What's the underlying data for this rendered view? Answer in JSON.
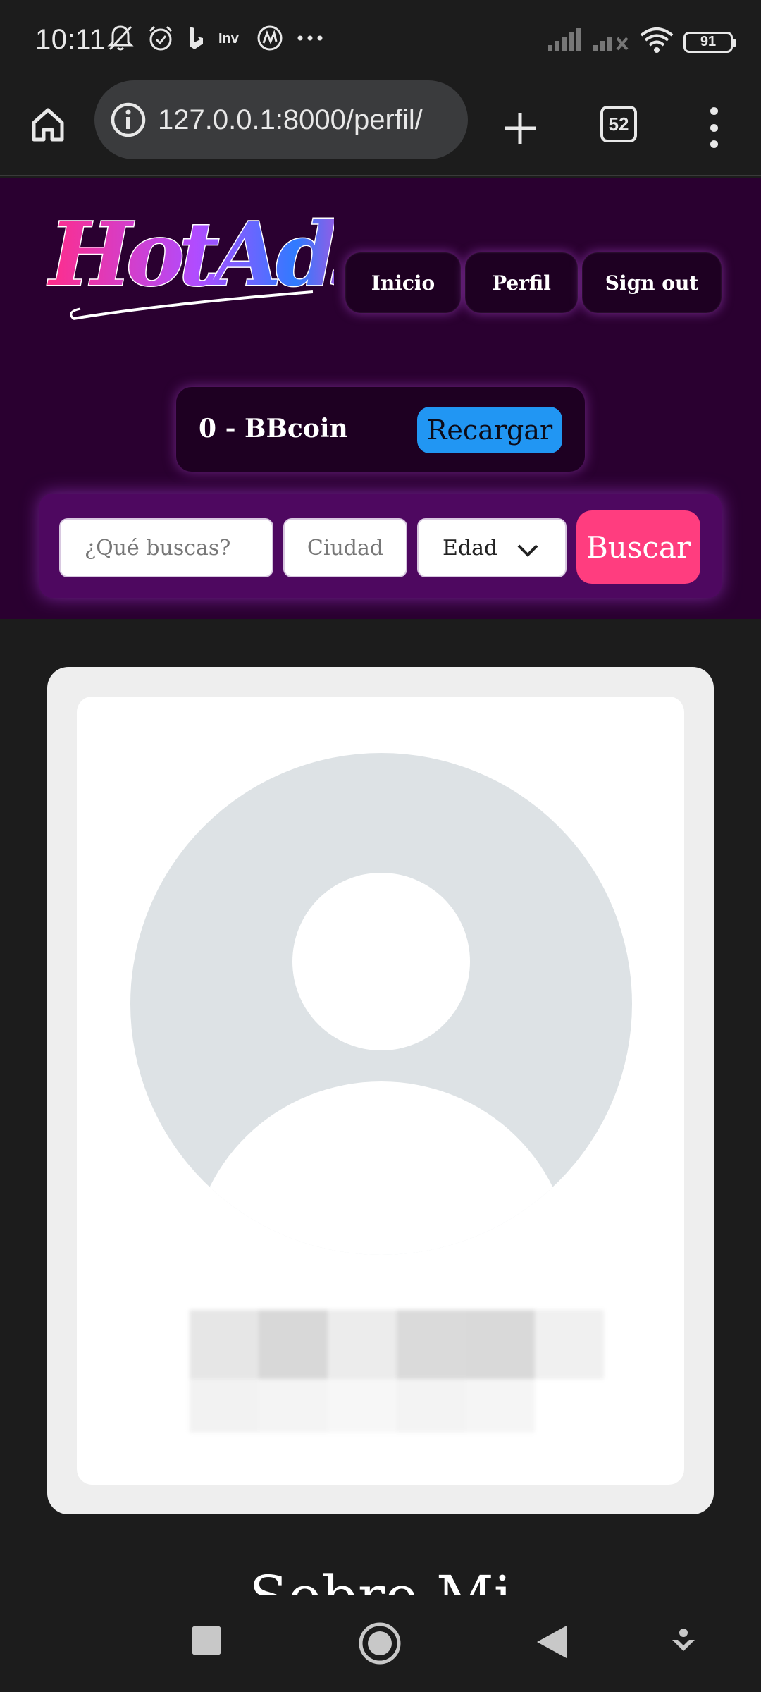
{
  "status_bar": {
    "time": "10:11",
    "battery_level": "91",
    "icons": [
      "mute-bell-icon",
      "alarm-icon",
      "bing-icon",
      "inv-icon",
      "app-icon",
      "more-icon",
      "signal-icon",
      "signal-off-icon",
      "wifi-icon",
      "battery-icon"
    ]
  },
  "browser": {
    "url": "127.0.0.1:8000/perfil/",
    "tab_count": "52"
  },
  "header": {
    "logo_text": "HotAds",
    "nav": {
      "inicio": "Inicio",
      "perfil": "Perfil",
      "sign_out": "Sign out"
    },
    "coin": {
      "balance": "0 - BBcoin",
      "recharge_label": "Recargar"
    },
    "search": {
      "query_placeholder": "¿Qué buscas?",
      "city_placeholder": "Ciudad",
      "age_selected": "Edad",
      "search_label": "Buscar"
    }
  },
  "profile": {
    "section_title": "Sobre Mi"
  },
  "colors": {
    "header_bg": "#2a0030",
    "search_bar_bg": "#4e0860",
    "recharge_button": "#2196f3",
    "search_button": "#ff3d7f",
    "page_bg": "#1c1c1c"
  }
}
